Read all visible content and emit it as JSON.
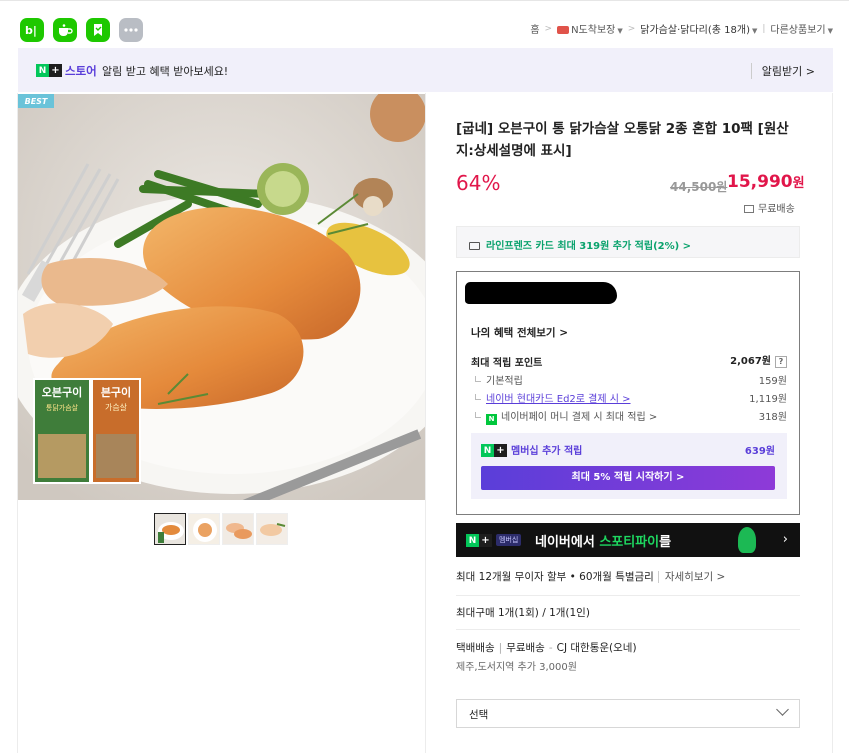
{
  "topbar": {
    "apps": [
      {
        "name": "blog-app",
        "label": "b|",
        "color": "#1ec800"
      },
      {
        "name": "cafe-app",
        "label": "",
        "color": "#1ec800"
      },
      {
        "name": "bookmark-app",
        "label": "",
        "color": "#1ec800"
      },
      {
        "name": "more-apps",
        "label": "•••",
        "color": "#b9bdc4"
      }
    ],
    "breadcrumbs": {
      "home": "홈",
      "guarantee": "N도착보장",
      "category": "닭가슴살·닭다리(총 18개)",
      "other": "다른상품보기"
    }
  },
  "store_banner": {
    "store_label": "스토어",
    "message": "알림 받고 혜택 받아보세요!",
    "alarm_label": "알림받기 >"
  },
  "product": {
    "badge": "BEST",
    "image_alt_text": "",
    "package_text_1": "오븐구이",
    "package_text_2": "통닭가슴살",
    "package_text_3": "븐구이",
    "package_text_4": "가슴살",
    "title": "[굽네] 오븐구이 통 닭가슴살 오통닭 2종 혼합 10팩 [원산지:상세설명에 표시]",
    "discount": "64%",
    "original_price": "44,500원",
    "sale_price": "15,990",
    "sale_currency": "원",
    "shipping": "무료배송",
    "thumbnails_count": 4
  },
  "card_promo": "라인프렌즈 카드 최대 319원 추가 적립(2%) >",
  "benefits": {
    "view_all": "나의 혜택 전체보기 >",
    "max_points_label": "최대 적립 포인트",
    "max_points_value": "2,067원",
    "help": "?",
    "rows": [
      {
        "label": "기본적립",
        "value": "159원",
        "link": false
      },
      {
        "label": "네이버 현대카드 Ed2로 결제 시 >",
        "value": "1,119원",
        "link": true
      },
      {
        "label": "네이버페이 머니 결제 시 최대 적립 >",
        "value": "318원",
        "link": false,
        "npay": "N"
      }
    ],
    "membership_label": "멤버십 추가 적립",
    "membership_value": "639원",
    "start_button": "최대 5% 적립 시작하기 >"
  },
  "spotify_banner": {
    "tag": "멤버십",
    "text_prefix": "네이버에서 ",
    "text_highlight": "스포티파이",
    "text_suffix": "를",
    "arrow": "›"
  },
  "installment": {
    "text": "최대 12개월 무이자 할부 • 60개월 특별금리",
    "more": "자세히보기 >"
  },
  "max_purchase": "최대구매 1개(1회) / 1개(1인)",
  "delivery": {
    "type": "택배배송",
    "fee": "무료배송",
    "courier": "CJ 대한통운(오네)",
    "extra": "제주,도서지역 추가 3,000원"
  },
  "select": {
    "label": "선택"
  },
  "colors": {
    "naver_green": "#03c75a",
    "accent_purple": "#5a3ed9",
    "price_red": "#e1164a",
    "promo_green": "#09a26c"
  }
}
